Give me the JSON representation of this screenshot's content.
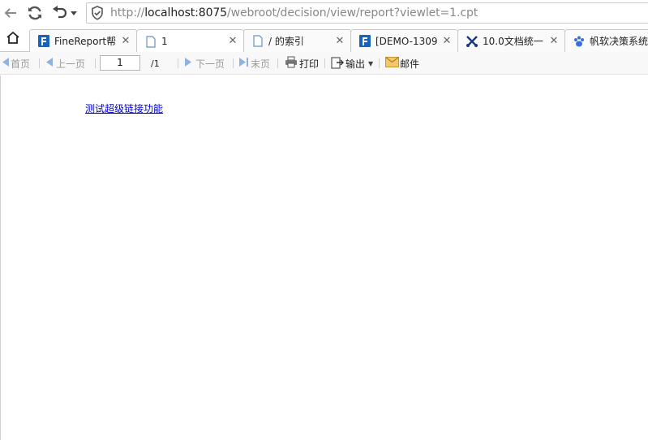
{
  "browser": {
    "address": {
      "protocol": "http://",
      "host": "localhost:8075",
      "path": "/webroot/decision/view/report?viewlet=1.cpt"
    },
    "tabs": [
      {
        "title": "FineReport帮",
        "icon": "finereport-logo-icon",
        "active": false
      },
      {
        "title": "1",
        "icon": "page-icon",
        "active": true
      },
      {
        "title": "/ 的索引",
        "icon": "page-icon",
        "active": false
      },
      {
        "title": "[DEMO-1309",
        "icon": "finereport-logo-icon",
        "active": false
      },
      {
        "title": "10.0文档统一",
        "icon": "tools-icon",
        "active": false
      },
      {
        "title": "帆软决策系统",
        "icon": "paw-icon",
        "active": false
      }
    ]
  },
  "toolbar": {
    "first_label": "首页",
    "prev_label": "上一页",
    "page_value": "1",
    "page_total": "/1",
    "next_label": "下一页",
    "last_label": "末页",
    "print_label": "打印",
    "export_label": "输出",
    "mail_label": "邮件"
  },
  "report": {
    "link_text": "测试超级链接功能"
  },
  "colors": {
    "link": "#0000cc",
    "disabled_text": "#9a9a9a",
    "toolbar_bg": "#f8f8f8",
    "brand_blue": "#1565c0"
  }
}
